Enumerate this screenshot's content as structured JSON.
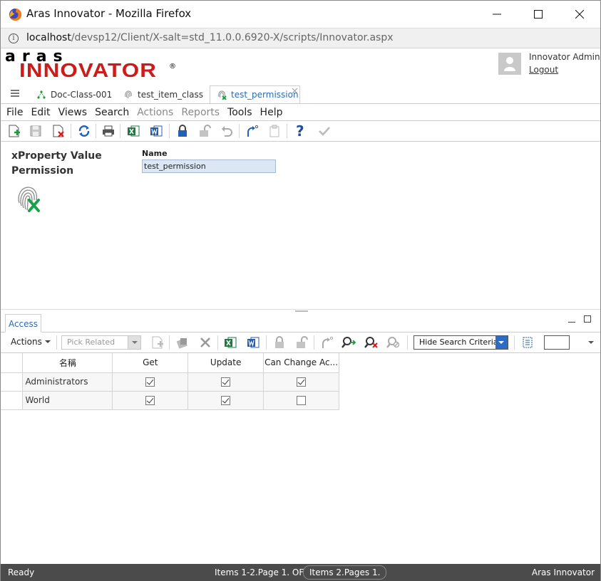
{
  "window": {
    "title": "Aras Innovator - Mozilla Firefox",
    "url_host": "localhost",
    "url_path": "/devsp12/Client/X-salt=std_11.0.0.6920-X/scripts/Innovator.aspx"
  },
  "header": {
    "logo_top": "aras",
    "logo_main": "INNOVATOR",
    "logo_reg": "®",
    "user_name": "Innovator Admin",
    "logout": "Logout"
  },
  "tabs": [
    {
      "label": "Doc-Class-001",
      "icon": "class-tree-icon"
    },
    {
      "label": "test_item_class",
      "icon": "fingerprint-icon"
    },
    {
      "label": "test_permission",
      "icon": "fingerprint-x-icon",
      "active": true
    }
  ],
  "menu": {
    "file": "File",
    "edit": "Edit",
    "views": "Views",
    "search": "Search",
    "actions": "Actions",
    "reports": "Reports",
    "tools": "Tools",
    "help": "Help"
  },
  "form": {
    "item_type_line1": "xProperty Value",
    "item_type_line2": "Permission",
    "name_label": "Name",
    "name_value": "test_permission"
  },
  "relationships": {
    "tab_label": "Access",
    "actions_label": "Actions",
    "pick_related_placeholder": "Pick Related",
    "search_mode": "Hide Search Criteria",
    "columns": [
      "名稱",
      "Get",
      "Update",
      "Can Change Ac..."
    ],
    "rows": [
      {
        "name": "Administrators",
        "get": true,
        "update": true,
        "can_change": true
      },
      {
        "name": "World",
        "get": true,
        "update": true,
        "can_change": false
      }
    ]
  },
  "status": {
    "left": "Ready",
    "items_page": "Items 1-2.Page 1. OF",
    "items_total": "Items 2.Pages 1.",
    "right": "Aras Innovator"
  },
  "colors": {
    "brand_red": "#cc1b1b",
    "accent_blue": "#2c6cc4",
    "statusbar": "#4b4b4b"
  }
}
